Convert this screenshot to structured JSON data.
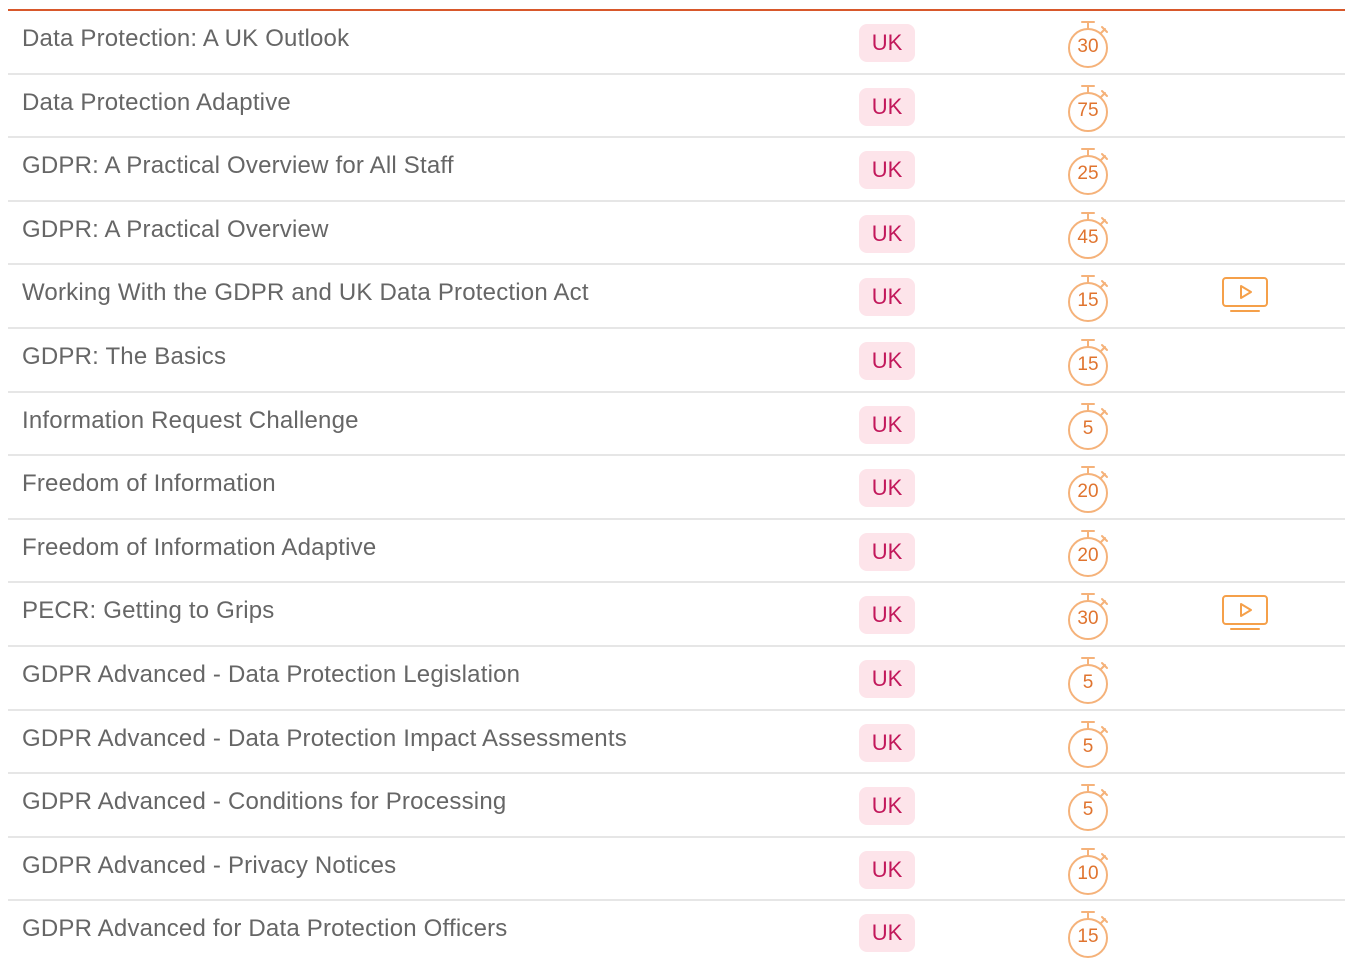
{
  "courses": [
    {
      "title": "Data Protection: A UK Outlook",
      "region": "UK",
      "minutes": "30",
      "has_video": false
    },
    {
      "title": "Data Protection Adaptive",
      "region": "UK",
      "minutes": "75",
      "has_video": false
    },
    {
      "title": "GDPR: A Practical Overview for All Staff",
      "region": "UK",
      "minutes": "25",
      "has_video": false
    },
    {
      "title": "GDPR: A Practical Overview",
      "region": "UK",
      "minutes": "45",
      "has_video": false
    },
    {
      "title": "Working With the GDPR and UK Data Protection Act",
      "region": "UK",
      "minutes": "15",
      "has_video": true
    },
    {
      "title": "GDPR: The Basics",
      "region": "UK",
      "minutes": "15",
      "has_video": false
    },
    {
      "title": "Information Request Challenge",
      "region": "UK",
      "minutes": "5",
      "has_video": false
    },
    {
      "title": "Freedom of Information",
      "region": "UK",
      "minutes": "20",
      "has_video": false
    },
    {
      "title": "Freedom of Information Adaptive",
      "region": "UK",
      "minutes": "20",
      "has_video": false
    },
    {
      "title": "PECR: Getting to Grips",
      "region": "UK",
      "minutes": "30",
      "has_video": true
    },
    {
      "title": "GDPR Advanced - Data Protection Legislation",
      "region": "UK",
      "minutes": "5",
      "has_video": false
    },
    {
      "title": "GDPR Advanced - Data Protection Impact Assessments",
      "region": "UK",
      "minutes": "5",
      "has_video": false
    },
    {
      "title": "GDPR Advanced - Conditions for Processing",
      "region": "UK",
      "minutes": "5",
      "has_video": false
    },
    {
      "title": "GDPR Advanced - Privacy Notices",
      "region": "UK",
      "minutes": "10",
      "has_video": false
    },
    {
      "title": "GDPR Advanced for Data Protection Officers",
      "region": "UK",
      "minutes": "15",
      "has_video": false
    }
  ],
  "colors": {
    "accent_rule": "#d8582b",
    "badge_bg": "#fde4ea",
    "badge_text": "#c2185b",
    "timer": "#e0742f",
    "timer_light": "#f5b27a",
    "row_divider": "#e6e6e6",
    "title_text": "#666666"
  },
  "icons": {
    "timer": "stopwatch-icon",
    "video": "video-play-icon"
  }
}
